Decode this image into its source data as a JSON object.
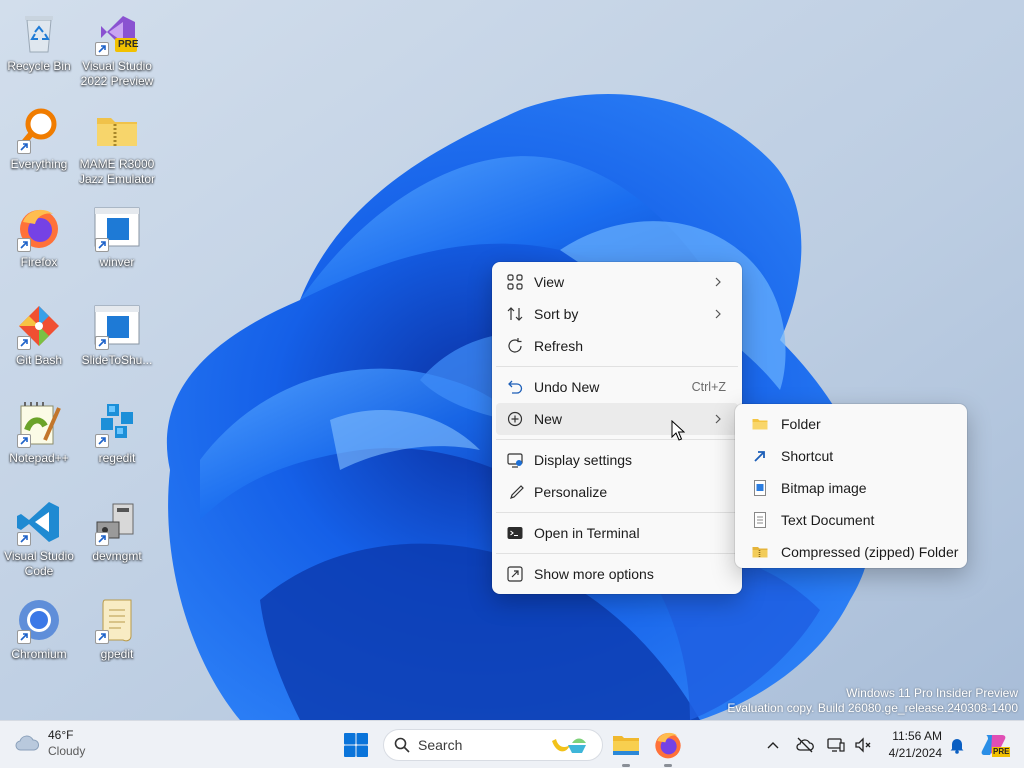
{
  "desktop": {
    "icons": [
      {
        "label": "Recycle Bin",
        "icon": "recycle-bin-icon"
      },
      {
        "label": "Visual Studio 2022 Preview",
        "line1": "Visual Studio",
        "line2": "2022 Preview",
        "badge": "PRE",
        "icon": "visual-studio-icon"
      },
      {
        "label": "Everything",
        "icon": "everything-search-icon"
      },
      {
        "label": "MAME R3000 Jazz Emulator",
        "line1": "MAME R3000",
        "line2": "Jazz Emulator",
        "icon": "zip-folder-icon"
      },
      {
        "label": "Firefox",
        "icon": "firefox-icon"
      },
      {
        "label": "winver",
        "icon": "window-app-icon"
      },
      {
        "label": "Git Bash",
        "icon": "git-icon"
      },
      {
        "label": "SlideToShu...",
        "icon": "window-app-icon"
      },
      {
        "label": "Notepad++",
        "icon": "notepad-plus-plus-icon"
      },
      {
        "label": "regedit",
        "icon": "registry-editor-icon"
      },
      {
        "label": "Visual Studio Code",
        "line1": "Visual Studio",
        "line2": "Code",
        "icon": "vscode-icon"
      },
      {
        "label": "devmgmt",
        "icon": "device-manager-icon"
      },
      {
        "label": "Chromium",
        "icon": "chromium-icon"
      },
      {
        "label": "gpedit",
        "icon": "policy-scroll-icon"
      }
    ]
  },
  "context_menu": {
    "items": [
      {
        "label": "View",
        "icon": "grid-icon",
        "submenu": true
      },
      {
        "label": "Sort by",
        "icon": "sort-icon",
        "submenu": true
      },
      {
        "label": "Refresh",
        "icon": "refresh-icon"
      },
      {
        "label": "Undo New",
        "icon": "undo-icon",
        "shortcut": "Ctrl+Z"
      },
      {
        "label": "New",
        "icon": "add-circle-icon",
        "submenu": true,
        "highlighted": true
      },
      {
        "label": "Display settings",
        "icon": "display-icon"
      },
      {
        "label": "Personalize",
        "icon": "brush-icon"
      },
      {
        "label": "Open in Terminal",
        "icon": "terminal-icon"
      },
      {
        "label": "Show more options",
        "icon": "more-options-icon"
      }
    ]
  },
  "new_submenu": {
    "items": [
      {
        "label": "Folder",
        "icon": "folder-icon"
      },
      {
        "label": "Shortcut",
        "icon": "shortcut-icon"
      },
      {
        "label": "Bitmap image",
        "icon": "bitmap-icon"
      },
      {
        "label": "Text Document",
        "icon": "text-document-icon"
      },
      {
        "label": "Compressed (zipped) Folder",
        "icon": "zip-folder-icon"
      }
    ]
  },
  "watermark": {
    "line1": "Windows 11 Pro Insider Preview",
    "line2": "Evaluation copy. Build 26080.ge_release.240308-1400"
  },
  "taskbar": {
    "weather": {
      "temp": "46°F",
      "condition": "Cloudy"
    },
    "search": {
      "placeholder": "Search"
    },
    "clock": {
      "time": "11:56 AM",
      "date": "4/21/2024"
    },
    "copilot_badge": "PRE"
  },
  "colors": {
    "accent": "#0067c0",
    "menu_bg": "#f9f9f9",
    "menu_highlight": "#ebebeb",
    "taskbar_bg": "#eef1f6"
  }
}
